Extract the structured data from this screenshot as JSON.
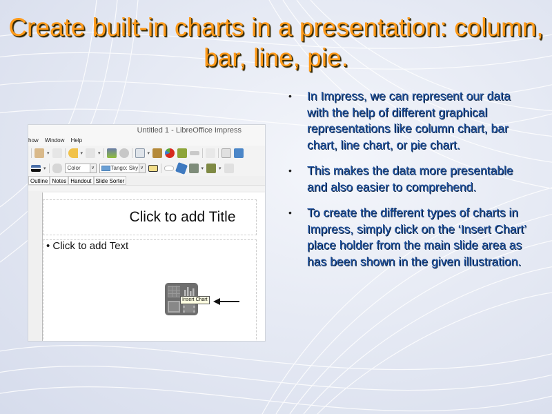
{
  "slide": {
    "title": "Create built-in charts in a presentation: column, bar, line, pie.",
    "title_color": "#ff9a1a",
    "body_color": "#1c4f9e",
    "bullets": [
      "In Impress, we can represent our data with the help of different graphical representations like column chart, bar chart, line chart, or pie chart.",
      "This makes the data more presentable and also easier to comprehend.",
      "To create the different types of charts in Impress, simply click on the ‘Insert Chart’ place holder from the main slide area as has been shown in the given illustration."
    ],
    "bullet_glyph": "•"
  },
  "screenshot": {
    "window_title": "Untitled 1 - LibreOffice Impress",
    "menu": [
      "how",
      "Window",
      "Help"
    ],
    "toolbar_icons": [
      "paste-icon",
      "clone-formatting-icon",
      "undo-icon",
      "redo-icon",
      "spelling-icon",
      "zoom-icon",
      "table-icon",
      "image-icon",
      "chart-icon",
      "movie-icon",
      "connector-icon",
      "hyperlink-icon",
      "slide-icon",
      "display-icon"
    ],
    "line_style_label": "",
    "fill_type": "Color",
    "fill_color": "Tango: Sky",
    "fill_swatch": "#6a9fd4",
    "view_tabs": [
      "Outline",
      "Notes",
      "Handout",
      "Slide Sorter"
    ],
    "title_placeholder": "Click to add Title",
    "text_placeholder": "Click to add Text",
    "tooltip": "Insert Chart"
  }
}
